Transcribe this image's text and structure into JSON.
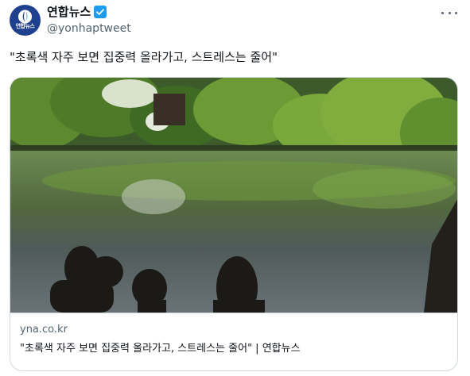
{
  "tweet": {
    "author": {
      "display_name": "연합뉴스",
      "handle": "@yonhaptweet",
      "avatar_text": "연합뉴스",
      "verified": true
    },
    "text": "\"초록색 자주 보면 집중력 올라가고, 스트레스는 줄어\"",
    "card": {
      "domain": "yna.co.kr",
      "title": "\"초록색 자주 보면 집중력 올라가고, 스트레스는 줄어\" | 연합뉴스"
    }
  },
  "colors": {
    "avatar_bg": "#1f3f8f",
    "verified_badge": "#1d9bf0",
    "secondary_text": "#536471",
    "border": "#cfd9de"
  },
  "icons": [
    "yonhap-logo-icon",
    "verified-badge-icon",
    "more-options-icon"
  ]
}
